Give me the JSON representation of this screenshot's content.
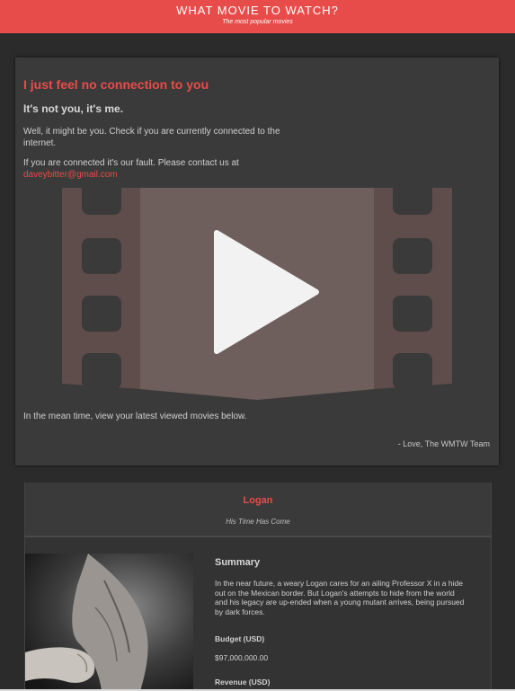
{
  "header": {
    "title": "WHAT MOVIE TO WATCH?",
    "subtitle": "The most popular movies"
  },
  "error_panel": {
    "heading": "I just feel no connection to you",
    "subheading": "It's not you, it's me.",
    "paragraph1": "Well, it might be you. Check if you are currently connected to the internet.",
    "paragraph2_prefix": "If you are connected it's our fault. Please contact us at",
    "email": "daveybitter@gmail.com",
    "meantime": "In the mean time, view your latest viewed movies below.",
    "signature": "- Love, The WMTW Team",
    "graphic_icon": "film-play-icon"
  },
  "movie": {
    "title": "Logan",
    "tagline": "His Time Has Come",
    "summary_label": "Summary",
    "summary": "In the near future, a weary Logan cares for an ailing Professor X in a hide out on the Mexican border. But Logan's attempts to hide from the world and his legacy are up-ended when a young mutant arrives, being pursued by dark forces.",
    "budget_label": "Budget (USD)",
    "budget_value": "$97,000,000.00",
    "revenue_label": "Revenue (USD)"
  },
  "colors": {
    "accent": "#e84c4a",
    "background": "#2b2b2b",
    "panel": "#3a3a3a",
    "film_dark": "#5e4d4b",
    "film_light": "#6e5f5c"
  }
}
